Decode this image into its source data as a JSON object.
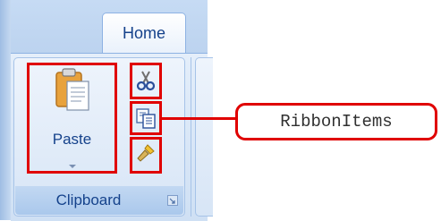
{
  "ribbon": {
    "tab_label": "Home",
    "group_label": "Clipboard",
    "paste_label": "Paste",
    "buttons": [
      {
        "name": "paste",
        "icon": "clipboard-paste-icon"
      },
      {
        "name": "cut",
        "icon": "scissors-icon"
      },
      {
        "name": "copy",
        "icon": "copy-icon"
      },
      {
        "name": "format-painter",
        "icon": "paintbrush-icon"
      }
    ]
  },
  "annotation": {
    "callout_text": "RibbonItems",
    "highlight_color": "#e00000"
  },
  "colors": {
    "ribbon_text": "#15428b",
    "ribbon_border": "#8db2e3"
  }
}
